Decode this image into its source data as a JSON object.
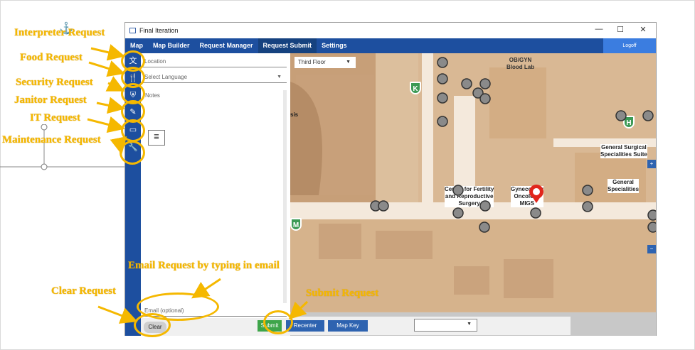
{
  "window": {
    "title": "Final Iteration",
    "minimize": "—",
    "maximize": "☐",
    "close": "✕"
  },
  "nav": {
    "items": [
      "Map",
      "Map Builder",
      "Request Manager",
      "Request Submit",
      "Settings"
    ],
    "active": "Request Submit",
    "logoff": "Logoff"
  },
  "form": {
    "location_placeholder": "Location",
    "language_placeholder": "Select Language",
    "notes_placeholder": "Notes",
    "email_placeholder": "Email (optional)",
    "clear_label": "Clear"
  },
  "map": {
    "floor": "Third Floor",
    "labels": [
      "OB/GYN\nBlood Lab",
      "General Surgical\nSpecialities Suite",
      "General\nSpecialities",
      "Center for Fertility\nand Reproductive\nSurgery",
      "Gynecology\nOncology\nMIGS",
      "sis"
    ],
    "letters": [
      "K",
      "H",
      "M"
    ]
  },
  "toolbar": {
    "submit": "Submit",
    "recenter": "Recenter",
    "map_key": "Map Key"
  },
  "annotations": [
    "Interpreter Request",
    "Food Request",
    "Security Request",
    "Janitor Request",
    "IT Request",
    "Maintenance Request",
    "Email Request by typing in email",
    "Clear Request",
    "Submit Request"
  ],
  "icons": {
    "interpreter": "translate-icon",
    "food": "food-icon",
    "security": "shield-icon",
    "janitor": "broom-icon",
    "it": "computer-icon",
    "maintenance": "wrench-icon",
    "anchor": "anchor-icon"
  },
  "colors": {
    "nav": "#1d4f9f",
    "accent": "#f5b800",
    "map_floor": "#d9b894",
    "submit": "#3ea54a",
    "node": "#888888",
    "pin": "#e1251b"
  }
}
